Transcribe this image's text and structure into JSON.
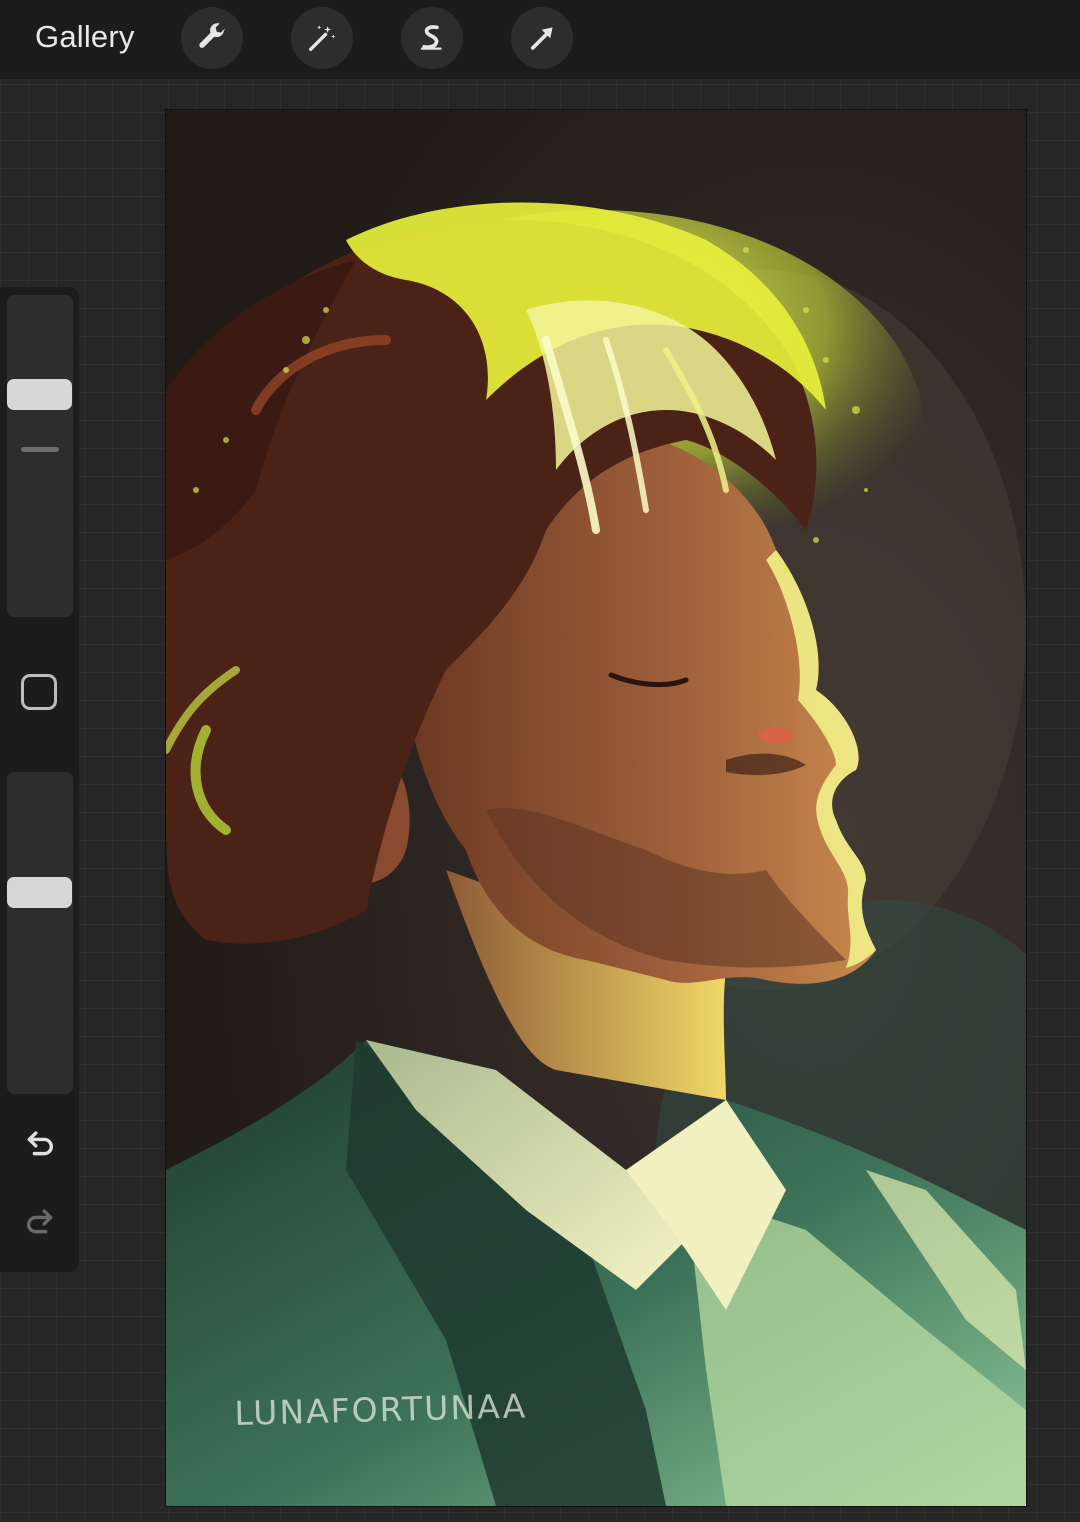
{
  "topbar": {
    "gallery_label": "Gallery",
    "tools": [
      {
        "name": "actions",
        "icon": "wrench-icon"
      },
      {
        "name": "adjustments",
        "icon": "magic-wand-icon"
      },
      {
        "name": "selection",
        "icon": "selection-s-icon"
      },
      {
        "name": "transform",
        "icon": "arrow-cursor-icon"
      }
    ]
  },
  "sidebar": {
    "brush_size": 0.29,
    "opacity": 0.36,
    "modify_icon": "square-icon",
    "undo_icon": "undo-icon",
    "redo_icon": "redo-icon"
  },
  "canvas": {
    "signature": "LUNAFORTUNAA"
  },
  "colors": {
    "toolbar_bg": "#1c1c1c",
    "workspace_bg": "#262626",
    "button_bg": "#2d2d2d",
    "thumb": "#d7d7d7",
    "highlight_yellow": "#e9ef3a",
    "suit_green": "#2f5a45",
    "hair_brown": "#4a2216",
    "skin": "#a0613c"
  }
}
